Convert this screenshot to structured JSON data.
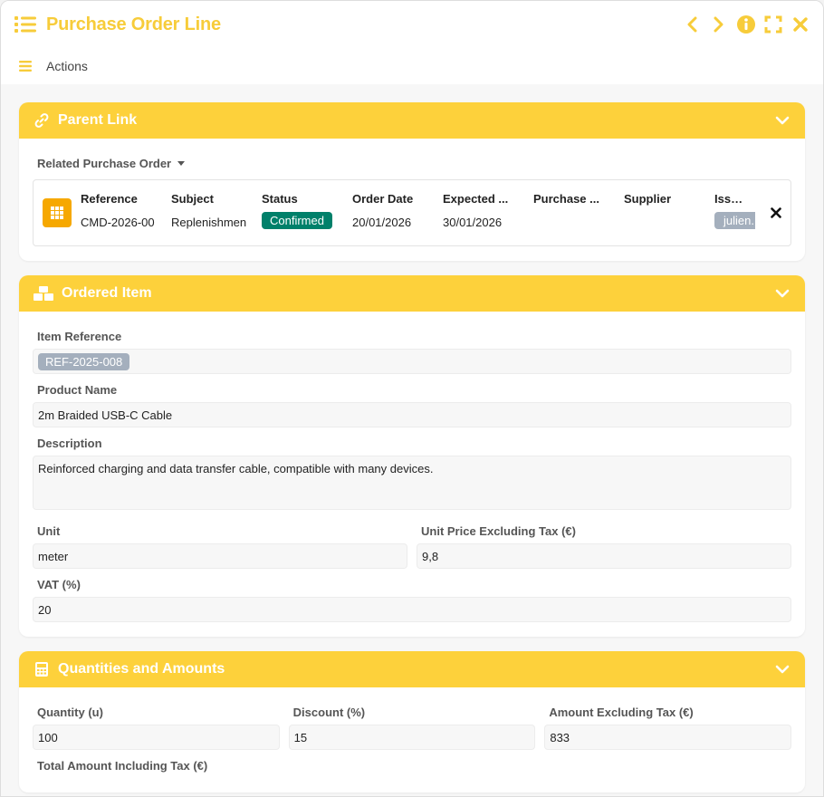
{
  "window": {
    "title": "Purchase Order Line",
    "accent": "#f7cc3a"
  },
  "actions": {
    "label": "Actions"
  },
  "parent_link": {
    "title": "Parent Link",
    "related_label": "Related Purchase Order",
    "columns": [
      "Reference",
      "Subject",
      "Status",
      "Order Date",
      "Expected ...",
      "Purchase ...",
      "Supplier",
      "Issuer"
    ],
    "row": {
      "reference": "CMD-2026-00",
      "subject": "Replenishmen",
      "status": "Confirmed",
      "order_date": "20/01/2026",
      "expected": "30/01/2026",
      "purchase": "",
      "supplier": "",
      "issuer": "julien."
    }
  },
  "ordered_item": {
    "title": "Ordered Item",
    "item_reference_label": "Item Reference",
    "item_reference_value": "REF-2025-008",
    "product_name_label": "Product Name",
    "product_name_value": "2m Braided USB-C Cable",
    "description_label": "Description",
    "description_value": "Reinforced charging and data transfer cable, compatible with many devices.",
    "unit_label": "Unit",
    "unit_value": "meter",
    "unit_price_label": "Unit Price Excluding Tax (€)",
    "unit_price_value": "9,8",
    "vat_label": "VAT (%)",
    "vat_value": "20"
  },
  "quantities": {
    "title": "Quantities and Amounts",
    "quantity_label": "Quantity (u)",
    "quantity_value": "100",
    "discount_label": "Discount (%)",
    "discount_value": "15",
    "amount_excl_label": "Amount Excluding Tax (€)",
    "amount_excl_value": "833",
    "total_incl_label": "Total Amount Including Tax (€)"
  }
}
